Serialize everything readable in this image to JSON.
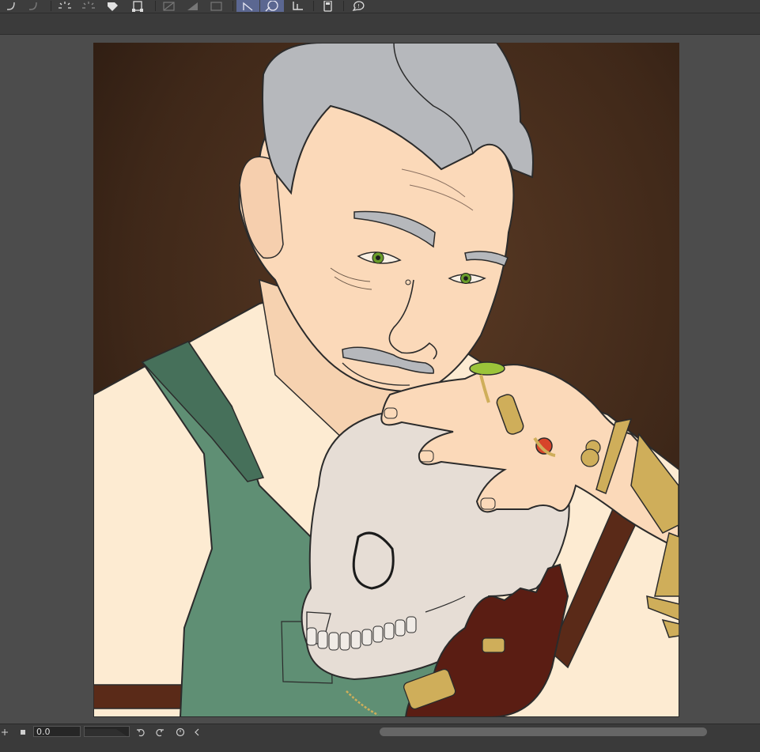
{
  "toolbar": {
    "items": [
      {
        "name": "undo-icon"
      },
      {
        "name": "redo-icon"
      },
      {
        "name": "select-all-icon"
      },
      {
        "name": "deselect-icon"
      },
      {
        "name": "fill-icon"
      },
      {
        "name": "transform-icon"
      },
      {
        "name": "ruler-icon"
      },
      {
        "name": "clear-icon"
      },
      {
        "name": "layer-mask-icon"
      },
      {
        "name": "lasso-select-icon",
        "active": true
      },
      {
        "name": "ellipse-select-icon",
        "active": true
      },
      {
        "name": "crop-icon"
      },
      {
        "name": "tablet-icon"
      },
      {
        "name": "help-icon"
      }
    ],
    "accent": "#5b6791"
  },
  "canvas": {
    "background": "#4c4c4c",
    "artwork_description_colors": {
      "backdrop": "#3a2418",
      "hair": "#b6b8bc",
      "skin": "#fbd9b9",
      "vest": "#5f8f74",
      "shirt": "#fdebd2",
      "skull": "#e6ddd5",
      "glove": "#5a1d13",
      "gold": "#cfae5a"
    }
  },
  "statusbar": {
    "rotation_value": "0.0",
    "zoom_level_fraction": 0.45,
    "scroll_thumb_fraction": 0.59
  }
}
